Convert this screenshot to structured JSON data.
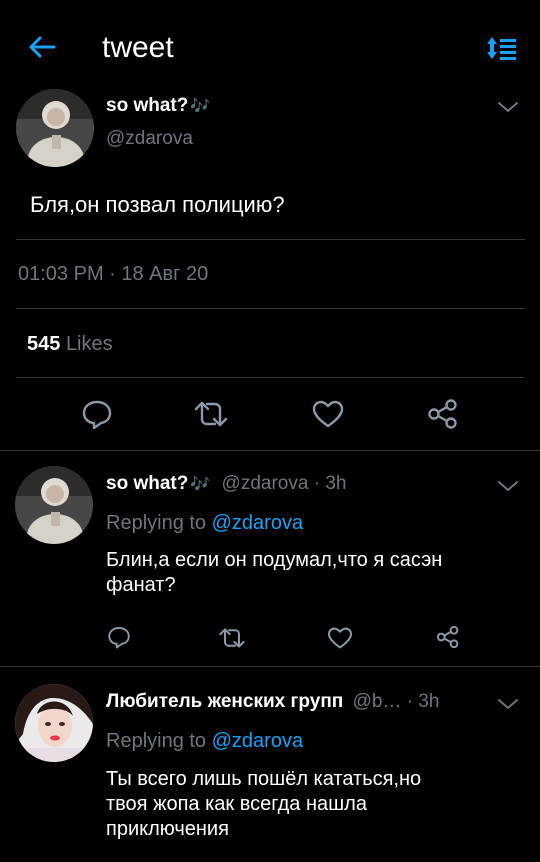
{
  "header": {
    "title": "tweet"
  },
  "main_tweet": {
    "display_name": "so what?",
    "name_emoji": "🎶",
    "handle": "@zdarova",
    "text": "Бля,он позвал полицию?",
    "timestamp": "01:03 PM · 18 Авг 20",
    "likes_count": "545",
    "likes_label": "Likes"
  },
  "replies": [
    {
      "display_name": "so what?",
      "name_emoji": "🎶",
      "handle_time": "@zdarova · 3h",
      "replying_prefix": "Replying to",
      "replying_to": "@zdarova",
      "text_line1": "Блин,а если он подумал,что я сасэн",
      "text_line2": "фанат?"
    },
    {
      "display_name": "Любитель женских групп",
      "handle_time": "@b… · 3h",
      "replying_prefix": "Replying to",
      "replying_to": "@zdarova",
      "text_line1": "Ты всего лишь пошёл кататься,но",
      "text_line2": "твоя жопа как всегда нашла",
      "text_line3": "приключения"
    }
  ],
  "colors": {
    "background": "#000000",
    "accent": "#1da1f2",
    "secondary_text": "#6e767d",
    "divider": "#2f3336",
    "icon": "#8b98a5",
    "emoji": "#b07de6"
  }
}
